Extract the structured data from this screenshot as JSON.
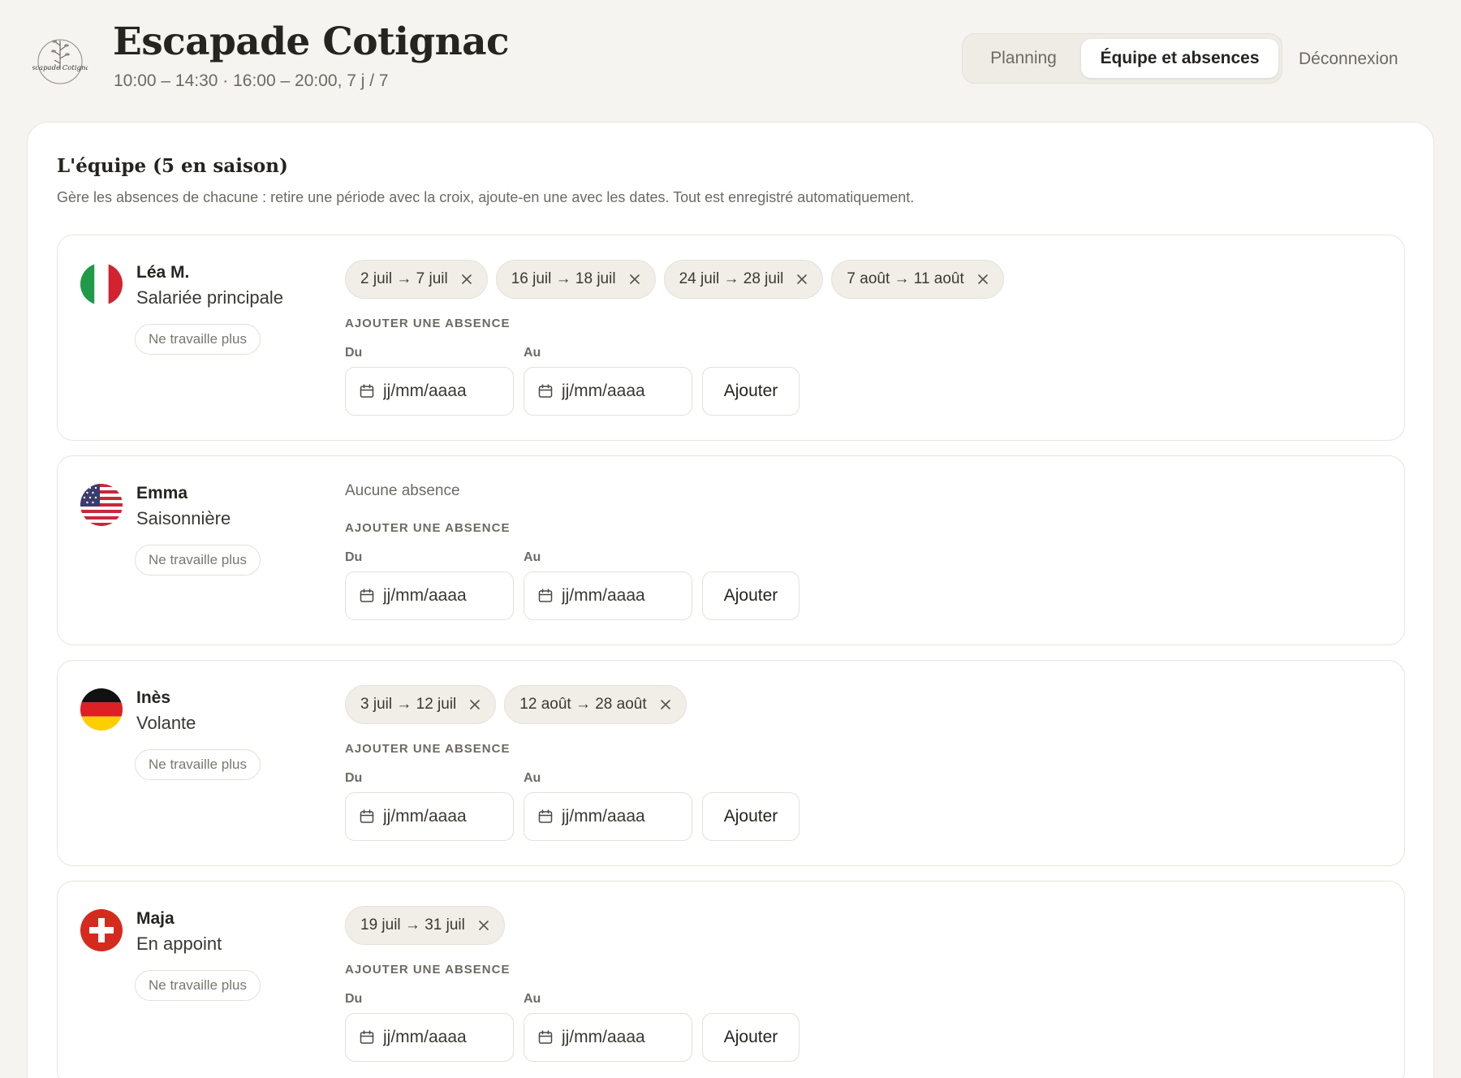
{
  "header": {
    "logo_text": "Escapade Cotignac",
    "title": "Escapade Cotignac",
    "subtitle": "10:00 – 14:30 · 16:00 – 20:00, 7 j / 7",
    "tabs": [
      {
        "label": "Planning",
        "active": false
      },
      {
        "label": "Équipe et absences",
        "active": true
      }
    ],
    "logout": "Déconnexion"
  },
  "team": {
    "title": "L'équipe (5 en saison)",
    "description": "Gère les absences de chacune : retire une période avec la croix, ajoute-en une avec les dates. Tout est enregistré automatiquement.",
    "members": [
      {
        "name": "Léa M.",
        "role": "Salariée principale",
        "flag": "italy-flag-icon",
        "status_button": "Ne travaille plus",
        "absences": [
          "2 juil → 7 juil",
          "16 juil → 18 juil",
          "24 juil → 28 juil",
          "7 août → 11 août"
        ],
        "no_absence_text": "",
        "add_title": "AJOUTER UNE ABSENCE",
        "from_label": "Du",
        "to_label": "Au",
        "from_placeholder": "jj/mm/aaaa",
        "to_placeholder": "jj/mm/aaaa",
        "add_button": "Ajouter"
      },
      {
        "name": "Emma",
        "role": "Saisonnière",
        "flag": "usa-flag-icon",
        "status_button": "Ne travaille plus",
        "absences": [],
        "no_absence_text": "Aucune absence",
        "add_title": "AJOUTER UNE ABSENCE",
        "from_label": "Du",
        "to_label": "Au",
        "from_placeholder": "jj/mm/aaaa",
        "to_placeholder": "jj/mm/aaaa",
        "add_button": "Ajouter"
      },
      {
        "name": "Inès",
        "role": "Volante",
        "flag": "germany-flag-icon",
        "status_button": "Ne travaille plus",
        "absences": [
          "3 juil → 12 juil",
          "12 août → 28 août"
        ],
        "no_absence_text": "",
        "add_title": "AJOUTER UNE ABSENCE",
        "from_label": "Du",
        "to_label": "Au",
        "from_placeholder": "jj/mm/aaaa",
        "to_placeholder": "jj/mm/aaaa",
        "add_button": "Ajouter"
      },
      {
        "name": "Maja",
        "role": "En appoint",
        "flag": "switzerland-flag-icon",
        "status_button": "Ne travaille plus",
        "absences": [
          "19 juil → 31 juil"
        ],
        "no_absence_text": "",
        "add_title": "AJOUTER UNE ABSENCE",
        "from_label": "Du",
        "to_label": "Au",
        "from_placeholder": "jj/mm/aaaa",
        "to_placeholder": "jj/mm/aaaa",
        "add_button": "Ajouter"
      }
    ]
  },
  "colors": {
    "background": "#f6f4f0",
    "panel": "#ffffff",
    "chip_bg": "#f1eee8",
    "text_primary": "#26241f",
    "text_muted": "#6d6a63"
  }
}
